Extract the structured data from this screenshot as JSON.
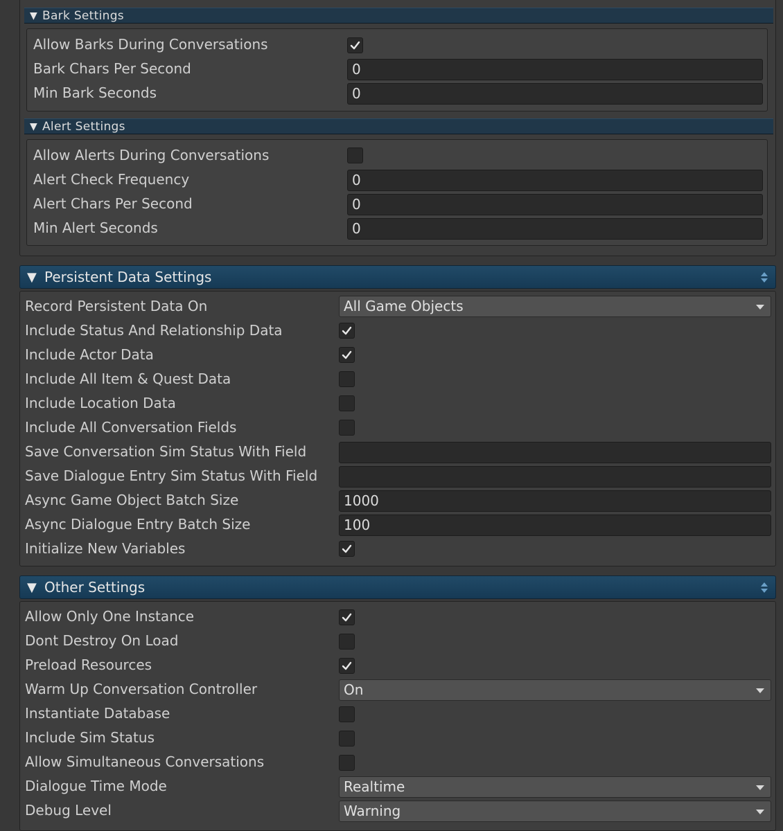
{
  "bark": {
    "header": "Bark Settings",
    "allow_label": "Allow Barks During Conversations",
    "allow_checked": true,
    "chars_label": "Bark Chars Per Second",
    "chars_value": "0",
    "min_label": "Min Bark Seconds",
    "min_value": "0"
  },
  "alert": {
    "header": "Alert Settings",
    "allow_label": "Allow Alerts During Conversations",
    "allow_checked": false,
    "freq_label": "Alert Check Frequency",
    "freq_value": "0",
    "chars_label": "Alert Chars Per Second",
    "chars_value": "0",
    "min_label": "Min Alert Seconds",
    "min_value": "0"
  },
  "persistent": {
    "header": "Persistent Data Settings",
    "record_label": "Record Persistent Data On",
    "record_value": "All Game Objects",
    "status_label": "Include Status And Relationship Data",
    "status_checked": true,
    "actor_label": "Include Actor Data",
    "actor_checked": true,
    "item_label": "Include All Item & Quest Data",
    "item_checked": false,
    "location_label": "Include Location Data",
    "location_checked": false,
    "convfields_label": "Include All Conversation Fields",
    "convfields_checked": false,
    "save_conv_label": "Save Conversation Sim Status With Field",
    "save_conv_value": "",
    "save_entry_label": "Save Dialogue Entry Sim Status With Field",
    "save_entry_value": "",
    "async_go_label": "Async Game Object Batch Size",
    "async_go_value": "1000",
    "async_de_label": "Async Dialogue Entry Batch Size",
    "async_de_value": "100",
    "init_label": "Initialize New Variables",
    "init_checked": true
  },
  "other": {
    "header": "Other Settings",
    "one_instance_label": "Allow Only One Instance",
    "one_instance_checked": true,
    "dont_destroy_label": "Dont Destroy On Load",
    "dont_destroy_checked": false,
    "preload_label": "Preload Resources",
    "preload_checked": true,
    "warmup_label": "Warm Up Conversation Controller",
    "warmup_value": "On",
    "instantiate_label": "Instantiate Database",
    "instantiate_checked": false,
    "sim_label": "Include Sim Status",
    "sim_checked": false,
    "simultaneous_label": "Allow Simultaneous Conversations",
    "simultaneous_checked": false,
    "time_mode_label": "Dialogue Time Mode",
    "time_mode_value": "Realtime",
    "debug_label": "Debug Level",
    "debug_value": "Warning"
  },
  "icons": {
    "foldout": "triangle-down-icon",
    "checkmark": "checkmark-icon",
    "sort": "sort-arrows-icon",
    "dropdown": "dropdown-arrow-icon"
  }
}
